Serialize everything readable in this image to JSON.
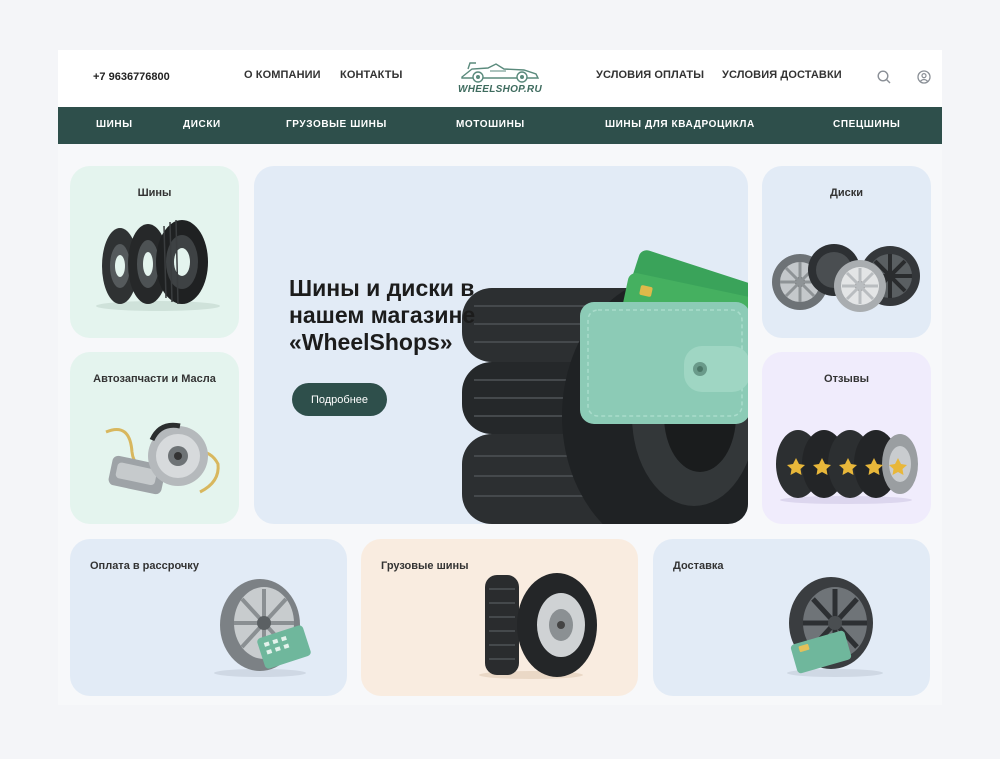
{
  "header": {
    "phone": "+7 9636776800",
    "links_left": [
      "О КОМПАНИИ",
      "КОНТАКТЫ"
    ],
    "logo_text": "WHEELSHOP.RU",
    "links_right": [
      "УСЛОВИЯ ОПЛАТЫ",
      "УСЛОВИЯ ДОСТАВКИ"
    ],
    "icons": [
      "search-icon",
      "user-icon"
    ]
  },
  "nav": {
    "items": [
      "ШИНЫ",
      "ДИСКИ",
      "ГРУЗОВЫЕ ШИНЫ",
      "МОТОШИНЫ",
      "ШИНЫ ДЛЯ КВАДРОЦИКЛА",
      "СПЕЦШИНЫ"
    ]
  },
  "hero": {
    "title": "Шины и диски в нашем магазине «WheelShops»",
    "button": "Подробнее"
  },
  "cards": {
    "tires": "Шины",
    "parts": "Автозапчасти и Масла",
    "wheels": "Диски",
    "reviews": "Отзывы",
    "installments": "Оплата в рассрочку",
    "truck": "Грузовые шины",
    "delivery": "Доставка"
  },
  "colors": {
    "dark_green": "#2e4f4b",
    "mint_card": "#e4f4ee",
    "blue_card": "#e2ebf6",
    "lavender_card": "#f0ecfc",
    "peach_card": "#f9ece0"
  }
}
